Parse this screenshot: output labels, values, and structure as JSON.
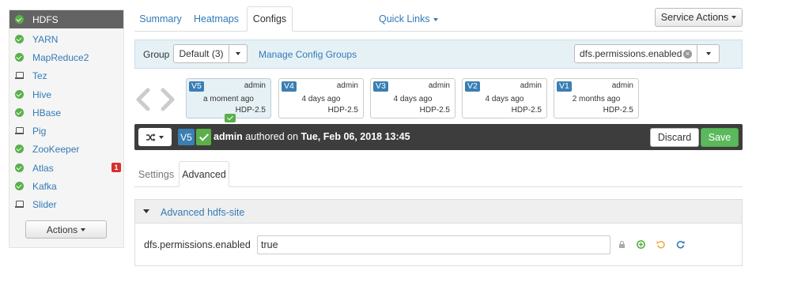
{
  "sidebar": {
    "items": [
      {
        "label": "HDFS",
        "icon": "check-circle-icon",
        "active": true
      },
      {
        "label": "YARN",
        "icon": "check-circle-icon"
      },
      {
        "label": "MapReduce2",
        "icon": "check-circle-icon"
      },
      {
        "label": "Tez",
        "icon": "laptop-icon"
      },
      {
        "label": "Hive",
        "icon": "check-circle-icon"
      },
      {
        "label": "HBase",
        "icon": "check-circle-icon"
      },
      {
        "label": "Pig",
        "icon": "laptop-icon"
      },
      {
        "label": "ZooKeeper",
        "icon": "check-circle-icon"
      },
      {
        "label": "Atlas",
        "icon": "check-circle-icon",
        "alerts": "1"
      },
      {
        "label": "Kafka",
        "icon": "check-circle-icon"
      },
      {
        "label": "Slider",
        "icon": "laptop-icon"
      }
    ],
    "actions_label": "Actions"
  },
  "tabs": {
    "summary": "Summary",
    "heatmaps": "Heatmaps",
    "configs": "Configs",
    "active": "Configs"
  },
  "quick_links": "Quick Links",
  "service_actions": "Service Actions",
  "group_bar": {
    "label": "Group",
    "selected": "Default (3)",
    "manage_link": "Manage Config Groups",
    "filter_value": "dfs.permissions.enabled"
  },
  "versions": [
    {
      "badge": "V5",
      "author": "admin",
      "date": "a moment ago",
      "stack": "HDP-2.5",
      "current": true
    },
    {
      "badge": "V4",
      "author": "admin",
      "date": "4 days ago",
      "stack": "HDP-2.5"
    },
    {
      "badge": "V3",
      "author": "admin",
      "date": "4 days ago",
      "stack": "HDP-2.5"
    },
    {
      "badge": "V2",
      "author": "admin",
      "date": "4 days ago",
      "stack": "HDP-2.5"
    },
    {
      "badge": "V1",
      "author": "admin",
      "date": "2 months ago",
      "stack": "HDP-2.5"
    }
  ],
  "version_bar": {
    "badge": "V5",
    "author": "admin",
    "authored_text": "authored on",
    "date": "Tue, Feb 06, 2018 13:45",
    "discard": "Discard",
    "save": "Save"
  },
  "subtabs": {
    "settings": "Settings",
    "advanced": "Advanced",
    "active": "Advanced"
  },
  "panel": {
    "title": "Advanced hdfs-site",
    "property_name": "dfs.permissions.enabled",
    "property_value": "true"
  },
  "colors": {
    "accent": "#337ab7",
    "success": "#5cb85c",
    "version_badge": "#3a7fb3",
    "dark_bar": "#3d3d3d",
    "alert": "#d9302c"
  }
}
